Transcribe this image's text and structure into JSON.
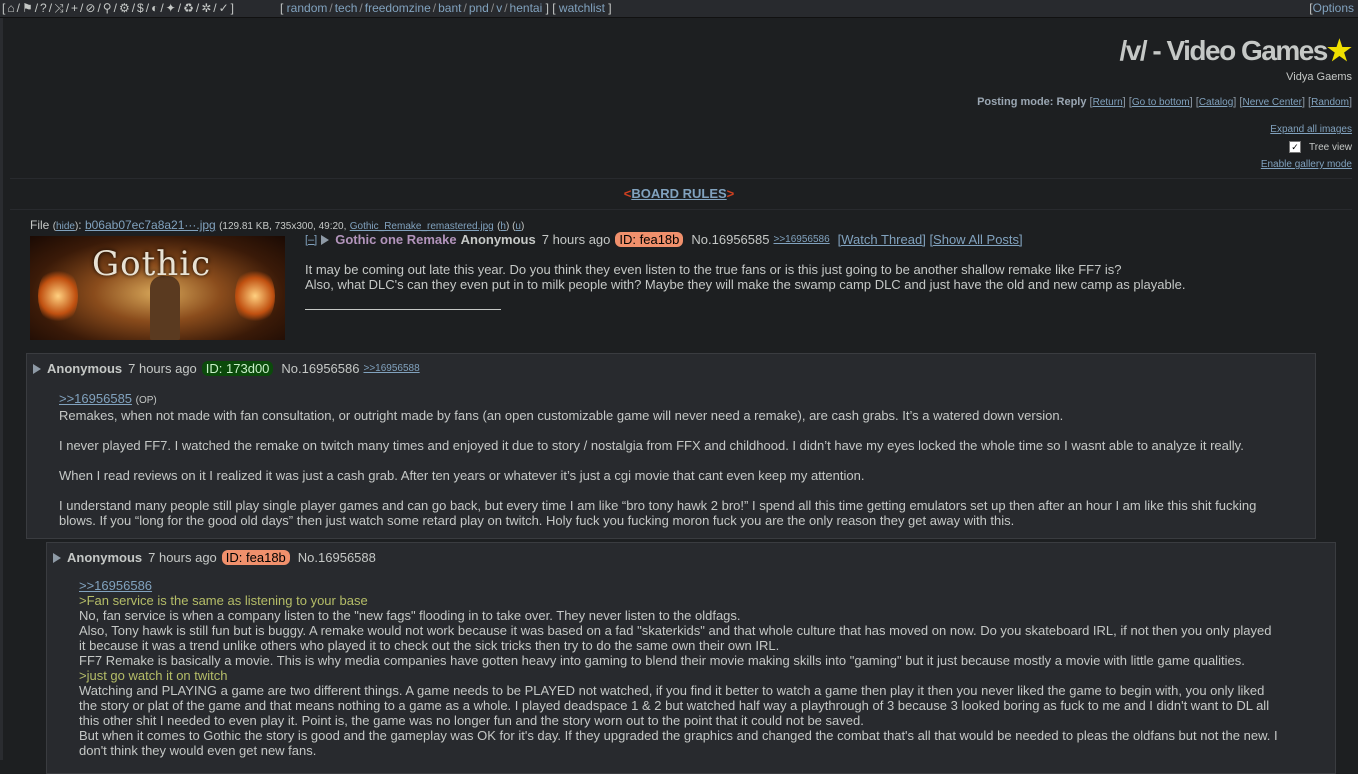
{
  "topbar": {
    "icons": [
      "home-icon",
      "tag-icon",
      "question-icon",
      "shuffle-icon",
      "plus-icon",
      "ban-icon",
      "search-icon",
      "gear-icon",
      "dollar-icon",
      "contrast-icon",
      "twitter-icon",
      "recycle-icon",
      "bug-icon",
      "check-icon"
    ],
    "icon_glyphs": [
      "⌂",
      "⚑",
      "?",
      "⤨",
      "+",
      "⊘",
      "⚲",
      "⚙",
      "$",
      "◐",
      "✦",
      "♻",
      "✲",
      "✓"
    ],
    "boards": [
      "random",
      "tech",
      "freedomzine",
      "bant",
      "pnd",
      "v",
      "hentai"
    ],
    "watchlist": "watchlist",
    "options": "Options"
  },
  "header": {
    "title": "/v/ - Video Games",
    "star": "★",
    "subtitle": "Vidya Gaems",
    "posting_mode_label": "Posting mode: Reply",
    "links": [
      "Return",
      "Go to bottom",
      "Catalog",
      "Nerve Center",
      "Random"
    ],
    "expand_images": "Expand all images",
    "tree_view": "Tree view",
    "tree_view_checked": true,
    "gallery_mode": "Enable gallery mode",
    "rules": "BOARD RULES"
  },
  "op": {
    "file_label": "File",
    "hide": "hide",
    "filename": "b06ab07ec7a8a21···.jpg",
    "file_meta": "(129.81 KB, 735x300, 49:20,",
    "original_name": "Gothic_Remake_remastered.jpg",
    "h": "h",
    "u": "u",
    "thumb_text": "Gothic",
    "minus": "[–]",
    "subject": "Gothic one Remake",
    "name": "Anonymous",
    "date": "7 hours ago",
    "id": "ID: fea18b",
    "post_no": "No.16956585",
    "backlink": ">>16956586",
    "watch": "[Watch Thread]",
    "show_all": "[Show All Posts]",
    "body": [
      "It may be coming out late this year. Do you think they even listen to the true fans or is this just going to be another shallow remake like FF7 is?",
      "Also, what DLC's can they even put in to milk people with? Maybe they will make the swamp camp DLC and just have the old and new camp as playable."
    ]
  },
  "reply1": {
    "name": "Anonymous",
    "date": "7 hours ago",
    "id": "ID: 173d00",
    "post_no": "No.16956586",
    "backlink": ">>16956588",
    "quote": ">>16956585",
    "op_mark": "(OP)",
    "paragraphs": [
      "Remakes, when not made with fan consultation, or outright made by fans (an open customizable game will never need a remake),  are cash grabs. It’s a watered down version.",
      "I never played FF7. I watched the remake on twitch many times and enjoyed it due to story / nostalgia from FFX and childhood.  I didn’t have my eyes locked the whole time so I wasnt able to analyze it really.",
      "When I read reviews on it I realized it was just a cash grab. After ten years or whatever it’s just a cgi movie that cant even keep my attention.",
      "I understand many people still play single player games and can go back, but every time I am like “bro tony hawk 2 bro!” I spend all this time getting emulators set up then after an hour I am like this shit fucking",
      "blows.  If you “long for the good old days” then just watch some retard play on twitch. Holy fuck you fucking moron fuck you are the only reason they get away with this."
    ]
  },
  "reply2": {
    "name": "Anonymous",
    "date": "7 hours ago",
    "id": "ID: fea18b",
    "post_no": "No.16956588",
    "quote": ">>16956586",
    "lines": [
      {
        "text": ">Fan service is the same as listening to your base",
        "green": true
      },
      {
        "text": "No, fan service is when a company listen to the \"new fags\" flooding in to take over. They never listen to the oldfags.",
        "green": false
      },
      {
        "text": "Also, Tony hawk is still fun but is buggy. A remake would not work because it was based on a fad \"skaterkids\" and that whole culture that has moved on now. Do you skateboard IRL, if not then you only played",
        "green": false
      },
      {
        "text": "it because it was a trend unlike others who played it to check out the sick tricks then try to do the same own their own IRL.",
        "green": false
      },
      {
        "text": "FF7 Remake is basically a movie. This is why media companies have gotten heavy into gaming to blend their movie making skills into \"gaming\" but it just because mostly a movie with little game qualities.",
        "green": false
      },
      {
        "text": ">just go watch it on twitch",
        "green": true
      },
      {
        "text": "Watching and PLAYING a game are two different things. A game needs to be PLAYED not watched, if you find it better to watch a game then play it then you never liked the game to begin with, you only liked",
        "green": false
      },
      {
        "text": "the story or plat of the game and that means nothing to a game as a whole. I played deadspace 1 & 2 but watched half way a playthrough of 3 because 3 looked boring as fuck to me and I didn't want to DL all",
        "green": false
      },
      {
        "text": "this other shit I needed to even play it. Point is, the game was no longer fun and the story worn out to the point that it could not be saved.",
        "green": false
      },
      {
        "text": "But when it comes to Gothic the story is good and the gameplay was OK for it's day. If they upgraded the graphics and changed the combat that's all that would be needed to pleas the oldfans but not the new. I",
        "green": false
      },
      {
        "text": "don't think they would even get new fans.",
        "green": false
      }
    ]
  }
}
